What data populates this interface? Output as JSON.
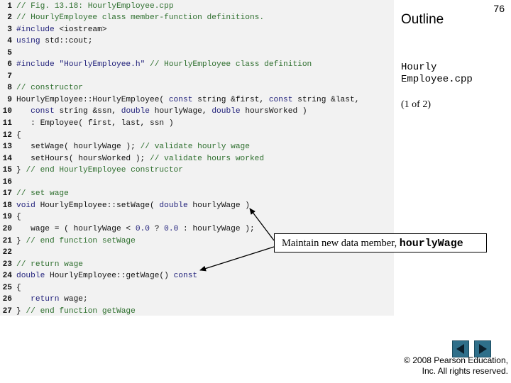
{
  "slide": {
    "outline_title": "Outline",
    "number": "76",
    "file_name_line1": "Hourly",
    "file_name_line2": "Employee.cpp",
    "page_indicator": "(1 of 2)",
    "callout_text": "Maintain new data member, ",
    "callout_code": "hourlyWage",
    "copyright_line1": "© 2008 Pearson Education,",
    "copyright_line2": "Inc. All rights reserved."
  },
  "code_lines": [
    {
      "n": "1",
      "tokens": [
        {
          "t": "// Fig. 13.18: HourlyEmployee.cpp",
          "c": "comment"
        }
      ]
    },
    {
      "n": "2",
      "tokens": [
        {
          "t": "// HourlyEmployee class member-function definitions.",
          "c": "comment"
        }
      ]
    },
    {
      "n": "3",
      "tokens": [
        {
          "t": "#include",
          "c": "kw"
        },
        {
          "t": " <iostream>",
          "c": "plain"
        }
      ]
    },
    {
      "n": "4",
      "tokens": [
        {
          "t": "using",
          "c": "kw"
        },
        {
          "t": " std::cout;",
          "c": "plain"
        }
      ]
    },
    {
      "n": "5",
      "tokens": []
    },
    {
      "n": "6",
      "tokens": [
        {
          "t": "#include",
          "c": "kw"
        },
        {
          "t": " ",
          "c": "plain"
        },
        {
          "t": "\"HourlyEmployee.h\"",
          "c": "str"
        },
        {
          "t": " // HourlyEmployee class definition",
          "c": "comment"
        }
      ]
    },
    {
      "n": "7",
      "tokens": []
    },
    {
      "n": "8",
      "tokens": [
        {
          "t": "// constructor",
          "c": "comment"
        }
      ]
    },
    {
      "n": "9",
      "tokens": [
        {
          "t": "HourlyEmployee::HourlyEmployee( ",
          "c": "plain"
        },
        {
          "t": "const",
          "c": "kw"
        },
        {
          "t": " string &first, ",
          "c": "plain"
        },
        {
          "t": "const",
          "c": "kw"
        },
        {
          "t": " string &last,",
          "c": "plain"
        }
      ]
    },
    {
      "n": "10",
      "tokens": [
        {
          "t": "   ",
          "c": "plain"
        },
        {
          "t": "const",
          "c": "kw"
        },
        {
          "t": " string &ssn, ",
          "c": "plain"
        },
        {
          "t": "double",
          "c": "kw"
        },
        {
          "t": " hourlyWage, ",
          "c": "plain"
        },
        {
          "t": "double",
          "c": "kw"
        },
        {
          "t": " hoursWorked )",
          "c": "plain"
        }
      ]
    },
    {
      "n": "11",
      "tokens": [
        {
          "t": "   : Employee( first, last, ssn )",
          "c": "plain"
        }
      ]
    },
    {
      "n": "12",
      "tokens": [
        {
          "t": "{",
          "c": "plain"
        }
      ]
    },
    {
      "n": "13",
      "tokens": [
        {
          "t": "   setWage( hourlyWage ); ",
          "c": "plain"
        },
        {
          "t": "// validate hourly wage",
          "c": "comment"
        }
      ]
    },
    {
      "n": "14",
      "tokens": [
        {
          "t": "   setHours( hoursWorked ); ",
          "c": "plain"
        },
        {
          "t": "// validate hours worked",
          "c": "comment"
        }
      ]
    },
    {
      "n": "15",
      "tokens": [
        {
          "t": "} ",
          "c": "plain"
        },
        {
          "t": "// end HourlyEmployee constructor",
          "c": "comment"
        }
      ]
    },
    {
      "n": "16",
      "tokens": []
    },
    {
      "n": "17",
      "tokens": [
        {
          "t": "// set wage",
          "c": "comment"
        }
      ]
    },
    {
      "n": "18",
      "tokens": [
        {
          "t": "void",
          "c": "kw"
        },
        {
          "t": " HourlyEmployee::setWage( ",
          "c": "plain"
        },
        {
          "t": "double",
          "c": "kw"
        },
        {
          "t": " hourlyWage )",
          "c": "plain"
        }
      ]
    },
    {
      "n": "19",
      "tokens": [
        {
          "t": "{",
          "c": "plain"
        }
      ]
    },
    {
      "n": "20",
      "tokens": [
        {
          "t": "   wage = ( hourlyWage < ",
          "c": "plain"
        },
        {
          "t": "0.0",
          "c": "num"
        },
        {
          "t": " ? ",
          "c": "plain"
        },
        {
          "t": "0.0",
          "c": "num"
        },
        {
          "t": " : hourlyWage );",
          "c": "plain"
        }
      ]
    },
    {
      "n": "21",
      "tokens": [
        {
          "t": "} ",
          "c": "plain"
        },
        {
          "t": "// end function setWage",
          "c": "comment"
        }
      ]
    },
    {
      "n": "22",
      "tokens": []
    },
    {
      "n": "23",
      "tokens": [
        {
          "t": "// return wage",
          "c": "comment"
        }
      ]
    },
    {
      "n": "24",
      "tokens": [
        {
          "t": "double",
          "c": "kw"
        },
        {
          "t": " HourlyEmployee::getWage() ",
          "c": "plain"
        },
        {
          "t": "const",
          "c": "kw"
        }
      ]
    },
    {
      "n": "25",
      "tokens": [
        {
          "t": "{",
          "c": "plain"
        }
      ]
    },
    {
      "n": "26",
      "tokens": [
        {
          "t": "   ",
          "c": "plain"
        },
        {
          "t": "return",
          "c": "kw"
        },
        {
          "t": " wage;",
          "c": "plain"
        }
      ]
    },
    {
      "n": "27",
      "tokens": [
        {
          "t": "} ",
          "c": "plain"
        },
        {
          "t": "// end function getWage",
          "c": "comment"
        }
      ]
    }
  ],
  "icons": {
    "prev": "triangle-left-icon",
    "next": "triangle-right-icon"
  },
  "colors": {
    "code_background": "#f2f2f2",
    "comment": "#2e6f2e",
    "keyword": "#1f1f7a",
    "nav_button": "#2f6f8a"
  }
}
